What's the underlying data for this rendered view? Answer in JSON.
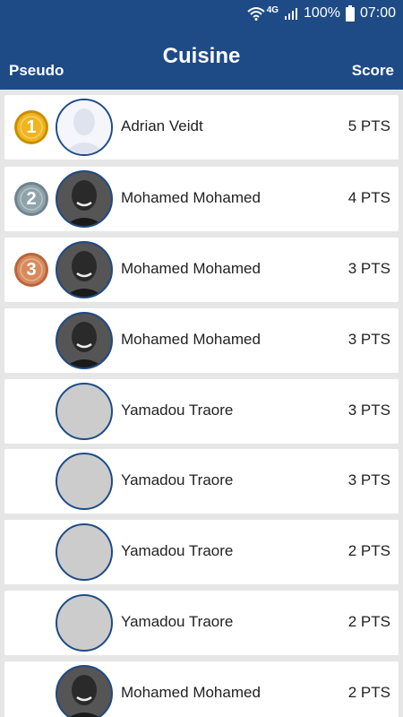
{
  "status_bar": {
    "network": "4G",
    "battery": "100%",
    "time": "07:00",
    "icons": [
      "wifi-icon",
      "signal-icon",
      "battery-icon"
    ]
  },
  "header": {
    "title": "Cuisine",
    "left_label": "Pseudo",
    "right_label": "Score"
  },
  "colors": {
    "primary": "#1e4b86",
    "gold": "#f0b51e",
    "silver": "#8fa3ab",
    "bronze": "#d88a5c"
  },
  "ranking": [
    {
      "rank": "1",
      "medal": "gold",
      "avatar": "placeholder-silhouette",
      "name": "Adrian Veidt",
      "score": "5 PTS"
    },
    {
      "rank": "2",
      "medal": "silver",
      "avatar": "photo",
      "name": "Mohamed Mohamed",
      "score": "4 PTS"
    },
    {
      "rank": "3",
      "medal": "bronze",
      "avatar": "photo",
      "name": "Mohamed Mohamed",
      "score": "3 PTS"
    },
    {
      "rank": "",
      "medal": "",
      "avatar": "photo",
      "name": "Mohamed Mohamed",
      "score": "3 PTS"
    },
    {
      "rank": "",
      "medal": "",
      "avatar": "empty",
      "name": "Yamadou Traore",
      "score": "3 PTS"
    },
    {
      "rank": "",
      "medal": "",
      "avatar": "empty",
      "name": "Yamadou Traore",
      "score": "3 PTS"
    },
    {
      "rank": "",
      "medal": "",
      "avatar": "empty",
      "name": "Yamadou Traore",
      "score": "2 PTS"
    },
    {
      "rank": "",
      "medal": "",
      "avatar": "empty",
      "name": "Yamadou Traore",
      "score": "2 PTS"
    },
    {
      "rank": "",
      "medal": "",
      "avatar": "photo",
      "name": "Mohamed Mohamed",
      "score": "2 PTS"
    }
  ]
}
